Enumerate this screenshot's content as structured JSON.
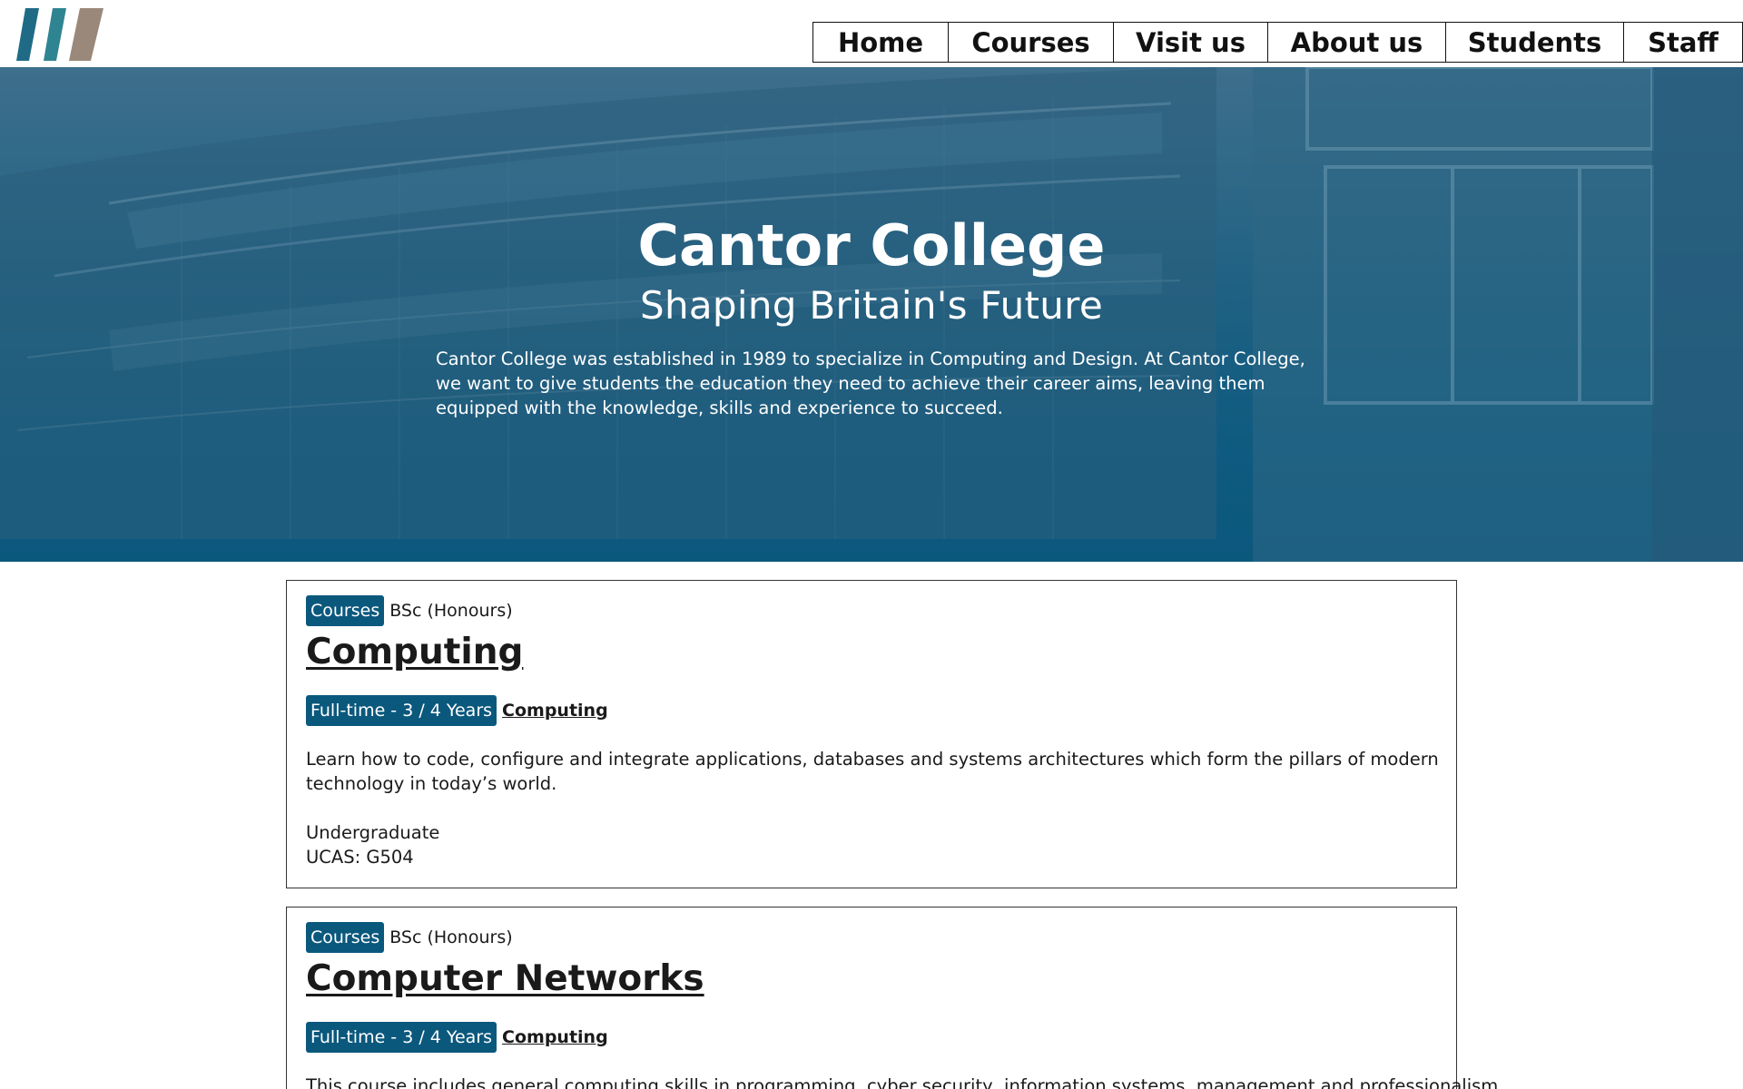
{
  "brand": {
    "logo_colors": [
      "#1f6b86",
      "#2f8491",
      "#9a887a"
    ]
  },
  "nav": {
    "items": [
      {
        "label": "Home"
      },
      {
        "label": "Courses"
      },
      {
        "label": "Visit us"
      },
      {
        "label": "About us"
      },
      {
        "label": "Students"
      },
      {
        "label": "Staff"
      }
    ]
  },
  "hero": {
    "title": "Cantor College",
    "subtitle": "Shaping Britain's Future",
    "intro": "Cantor College was established in 1989 to specialize in Computing and Design. At Cantor College, we want to give students the education they need to achieve their career aims, leaving them equipped with the knowledge, skills and experience to succeed.",
    "overlay_color": "#0b587d"
  },
  "courses": [
    {
      "tag": "Courses",
      "degree": "BSc (Honours)",
      "title": "Computing",
      "mode": "Full-time - 3 / 4 Years",
      "department": "Computing",
      "description": "Learn how to code, configure and integrate applications, databases and systems architectures which form the pillars of modern technology in today’s world.",
      "level": "Undergraduate",
      "ucas": "UCAS: G504"
    },
    {
      "tag": "Courses",
      "degree": "BSc (Honours)",
      "title": "Computer Networks",
      "mode": "Full-time - 3 / 4 Years",
      "department": "Computing",
      "description": "This course includes general computing skills in programming, cyber security, information systems, management and professionalism"
    }
  ],
  "colors": {
    "accent": "#0b587d",
    "text": "#1a1a1a",
    "border": "#333333"
  }
}
